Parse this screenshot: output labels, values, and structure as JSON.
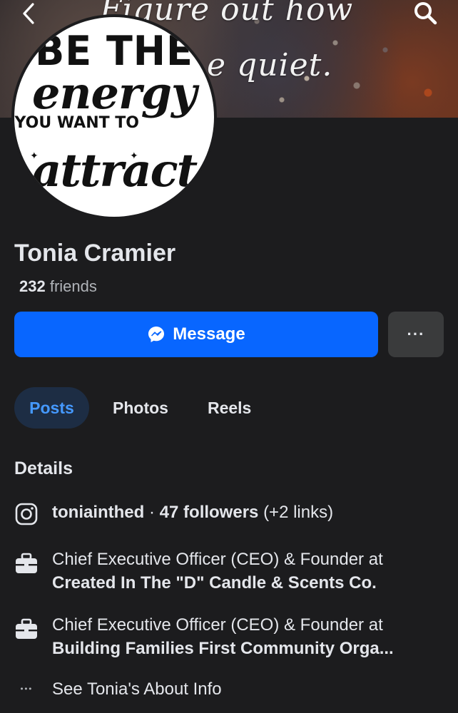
{
  "cover": {
    "line1": "Figure out how",
    "line2": "e quiet."
  },
  "nav": {
    "back_icon": "chevron-left-icon",
    "search_icon": "search-icon"
  },
  "avatar": {
    "line1": "BE THE",
    "line2": "energy",
    "line3": "YOU WANT TO",
    "line4": "attract"
  },
  "profile": {
    "name": "Tonia Cramier",
    "friends_count": "232",
    "friends_label": "friends"
  },
  "actions": {
    "message_label": "Message",
    "more_label": "···"
  },
  "tabs": [
    {
      "label": "Posts",
      "active": true
    },
    {
      "label": "Photos",
      "active": false
    },
    {
      "label": "Reels",
      "active": false
    }
  ],
  "details": {
    "heading": "Details",
    "instagram": {
      "icon": "instagram-icon",
      "handle": "toniainthed",
      "separator": "·",
      "followers": "47 followers",
      "extra": "(+2 links)"
    },
    "work": [
      {
        "icon": "briefcase-icon",
        "title": "Chief Executive Officer (CEO) & Founder at",
        "org": "Created In The \"D\" Candle & Scents Co."
      },
      {
        "icon": "briefcase-icon",
        "title": "Chief Executive Officer (CEO) & Founder at",
        "org": "Building Families First Community Orga..."
      }
    ],
    "about": {
      "icon": "more-dots-icon",
      "label": "See Tonia's About Info"
    }
  },
  "colors": {
    "background": "#1c1c1e",
    "primary_button": "#0866ff",
    "secondary_button": "#3a3b3c",
    "active_tab_bg": "#1d2d44",
    "active_tab_text": "#4599ff",
    "text_primary": "#e4e6eb",
    "text_secondary": "#b0b3b8"
  }
}
